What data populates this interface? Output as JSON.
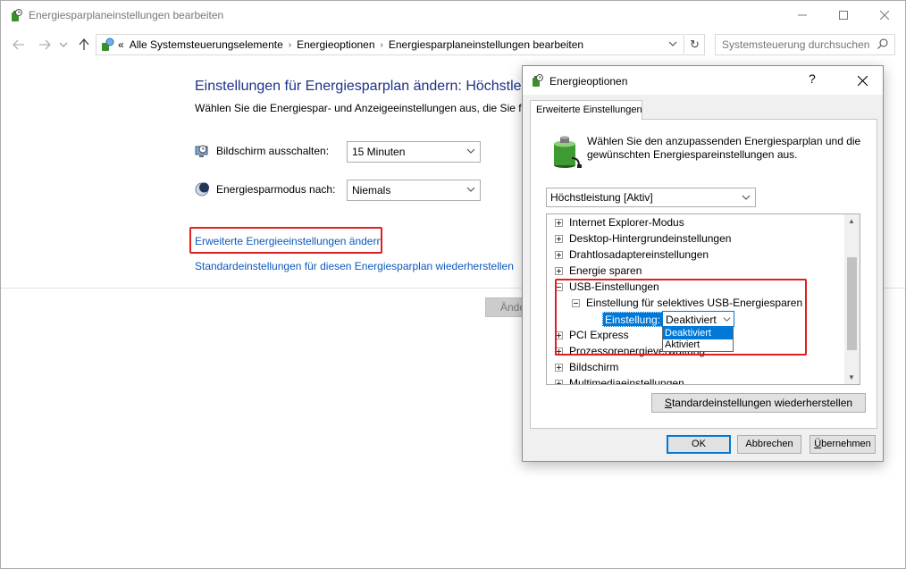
{
  "window": {
    "title": "Energiesparplaneinstellungen bearbeiten",
    "icons": {
      "app": "power-plan-icon",
      "minimize": "minimize-icon",
      "maximize": "maximize-icon",
      "close": "close-icon"
    }
  },
  "addressbar": {
    "overflow": "«",
    "breadcrumbs": [
      "Alle Systemsteuerungselemente",
      "Energieoptionen",
      "Energiesparplaneinstellungen bearbeiten"
    ],
    "search_placeholder": "Systemsteuerung durchsuchen"
  },
  "main": {
    "title": "Einstellungen für Energiesparplan ändern: Höchstleist",
    "description": "Wählen Sie die Energiespar- und Anzeigeeinstellungen aus, die Sie für",
    "settings": [
      {
        "label": "Bildschirm ausschalten:",
        "value": "15 Minuten",
        "icon": "monitor-clock-icon"
      },
      {
        "label": "Energiesparmodus nach:",
        "value": "Niemals",
        "icon": "moon-icon"
      }
    ],
    "links": {
      "advanced": "Erweiterte Energieeinstellungen ändern",
      "restore": "Standardeinstellungen für diesen Energiesparplan wiederherstellen"
    },
    "hidden_button": "Ände"
  },
  "dialog": {
    "title": "Energieoptionen",
    "help": "?",
    "tab": "Erweiterte Einstellungen",
    "description": "Wählen Sie den anzupassenden Energiesparplan und die gewünschten Energiespareinstellungen aus.",
    "plan": "Höchstleistung [Aktiv]",
    "tree": [
      {
        "label": "Internet Explorer-Modus",
        "expanded": false
      },
      {
        "label": "Desktop-Hintergrundeinstellungen",
        "expanded": false
      },
      {
        "label": "Drahtlosadaptereinstellungen",
        "expanded": false
      },
      {
        "label": "Energie sparen",
        "expanded": false
      },
      {
        "label": "USB-Einstellungen",
        "expanded": true
      },
      {
        "label": "Einstellung für selektives USB-Energiesparen",
        "expanded": true,
        "level": 1
      },
      {
        "label": "PCI Express",
        "expanded": false
      },
      {
        "label": "Prozessorenergieverwaltung",
        "expanded": false
      },
      {
        "label": "Bildschirm",
        "expanded": false
      },
      {
        "label": "Multimediaeinstellungen",
        "expanded": false
      }
    ],
    "setting_label": "Einstellung:",
    "setting_value": "Deaktiviert",
    "dropdown_options": [
      "Deaktiviert",
      "Aktiviert"
    ],
    "restore_button": {
      "pre": "",
      "u": "S",
      "post": "tandardeinstellungen wiederherstellen"
    },
    "buttons": {
      "ok": "OK",
      "cancel": "Abbrechen",
      "apply": {
        "u": "Ü",
        "post": "bernehmen"
      }
    }
  }
}
